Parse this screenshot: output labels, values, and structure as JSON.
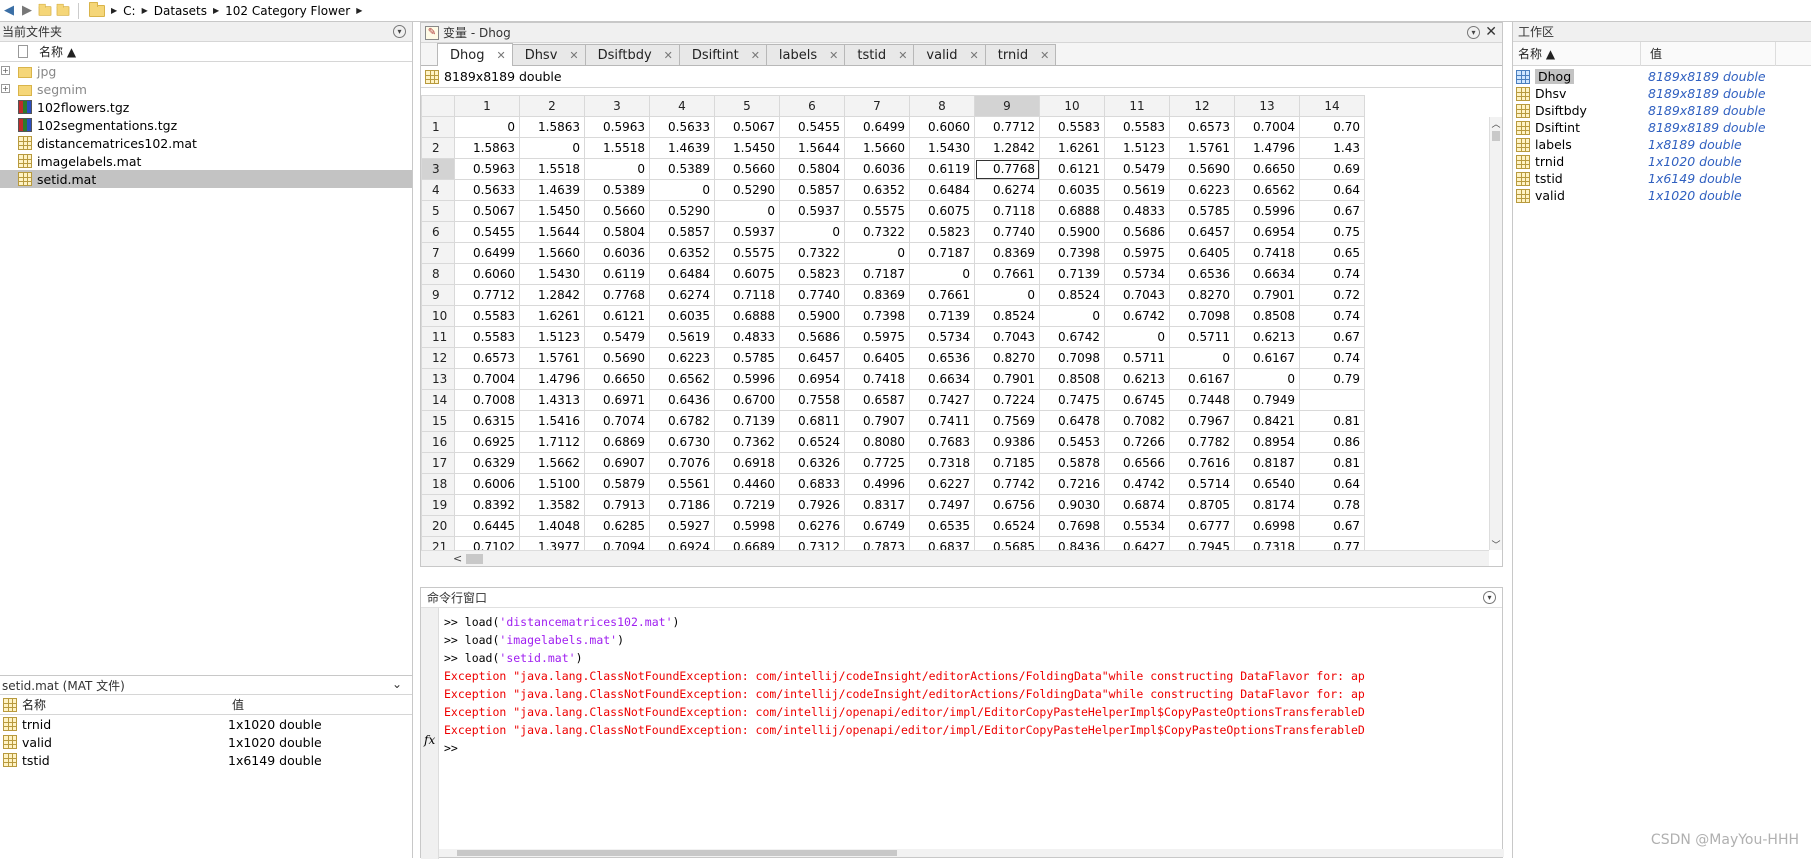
{
  "address": {
    "drive": "C:",
    "crumbs": [
      "Datasets",
      "102 Category Flower"
    ]
  },
  "current_folder": {
    "title": "当前文件夹",
    "col_name": "名称 ▲",
    "items": [
      {
        "name": "jpg",
        "type": "folder",
        "dim": true
      },
      {
        "name": "segmim",
        "type": "folder",
        "dim": true
      },
      {
        "name": "102flowers.tgz",
        "type": "tgz"
      },
      {
        "name": "102segmentations.tgz",
        "type": "tgz"
      },
      {
        "name": "distancematrices102.mat",
        "type": "mat"
      },
      {
        "name": "imagelabels.mat",
        "type": "mat"
      },
      {
        "name": "setid.mat",
        "type": "mat",
        "selected": true
      }
    ]
  },
  "details": {
    "title": "setid.mat  (MAT 文件)",
    "col_name": "名称",
    "col_value": "值",
    "items": [
      {
        "name": "trnid",
        "value": "1x1020 double"
      },
      {
        "name": "valid",
        "value": "1x1020 double"
      },
      {
        "name": "tstid",
        "value": "1x6149 double"
      }
    ]
  },
  "variable_editor": {
    "title": "变量 - Dhog",
    "tabs": [
      "Dhog",
      "Dhsv",
      "Dsiftbdy",
      "Dsiftint",
      "labels",
      "tstid",
      "valid",
      "trnid"
    ],
    "active_tab": "Dhog",
    "size_label": "8189x8189 double",
    "columns": [
      "1",
      "2",
      "3",
      "4",
      "5",
      "6",
      "7",
      "8",
      "9",
      "10",
      "11",
      "12",
      "13",
      "14"
    ],
    "rows": [
      [
        "0",
        "1.5863",
        "0.5963",
        "0.5633",
        "0.5067",
        "0.5455",
        "0.6499",
        "0.6060",
        "0.7712",
        "0.5583",
        "0.5583",
        "0.6573",
        "0.7004",
        "0.70"
      ],
      [
        "1.5863",
        "0",
        "1.5518",
        "1.4639",
        "1.5450",
        "1.5644",
        "1.5660",
        "1.5430",
        "1.2842",
        "1.6261",
        "1.5123",
        "1.5761",
        "1.4796",
        "1.43"
      ],
      [
        "0.5963",
        "1.5518",
        "0",
        "0.5389",
        "0.5660",
        "0.5804",
        "0.6036",
        "0.6119",
        "0.7768",
        "0.6121",
        "0.5479",
        "0.5690",
        "0.6650",
        "0.69"
      ],
      [
        "0.5633",
        "1.4639",
        "0.5389",
        "0",
        "0.5290",
        "0.5857",
        "0.6352",
        "0.6484",
        "0.6274",
        "0.6035",
        "0.5619",
        "0.6223",
        "0.6562",
        "0.64"
      ],
      [
        "0.5067",
        "1.5450",
        "0.5660",
        "0.5290",
        "0",
        "0.5937",
        "0.5575",
        "0.6075",
        "0.7118",
        "0.6888",
        "0.4833",
        "0.5785",
        "0.5996",
        "0.67"
      ],
      [
        "0.5455",
        "1.5644",
        "0.5804",
        "0.5857",
        "0.5937",
        "0",
        "0.7322",
        "0.5823",
        "0.7740",
        "0.5900",
        "0.5686",
        "0.6457",
        "0.6954",
        "0.75"
      ],
      [
        "0.6499",
        "1.5660",
        "0.6036",
        "0.6352",
        "0.5575",
        "0.7322",
        "0",
        "0.7187",
        "0.8369",
        "0.7398",
        "0.5975",
        "0.6405",
        "0.7418",
        "0.65"
      ],
      [
        "0.6060",
        "1.5430",
        "0.6119",
        "0.6484",
        "0.6075",
        "0.5823",
        "0.7187",
        "0",
        "0.7661",
        "0.7139",
        "0.5734",
        "0.6536",
        "0.6634",
        "0.74"
      ],
      [
        "0.7712",
        "1.2842",
        "0.7768",
        "0.6274",
        "0.7118",
        "0.7740",
        "0.8369",
        "0.7661",
        "0",
        "0.8524",
        "0.7043",
        "0.8270",
        "0.7901",
        "0.72"
      ],
      [
        "0.5583",
        "1.6261",
        "0.6121",
        "0.6035",
        "0.6888",
        "0.5900",
        "0.7398",
        "0.7139",
        "0.8524",
        "0",
        "0.6742",
        "0.7098",
        "0.8508",
        "0.74"
      ],
      [
        "0.5583",
        "1.5123",
        "0.5479",
        "0.5619",
        "0.4833",
        "0.5686",
        "0.5975",
        "0.5734",
        "0.7043",
        "0.6742",
        "0",
        "0.5711",
        "0.6213",
        "0.67"
      ],
      [
        "0.6573",
        "1.5761",
        "0.5690",
        "0.6223",
        "0.5785",
        "0.6457",
        "0.6405",
        "0.6536",
        "0.8270",
        "0.7098",
        "0.5711",
        "0",
        "0.6167",
        "0.74"
      ],
      [
        "0.7004",
        "1.4796",
        "0.6650",
        "0.6562",
        "0.5996",
        "0.6954",
        "0.7418",
        "0.6634",
        "0.7901",
        "0.8508",
        "0.6213",
        "0.6167",
        "0",
        "0.79"
      ],
      [
        "0.7008",
        "1.4313",
        "0.6971",
        "0.6436",
        "0.6700",
        "0.7558",
        "0.6587",
        "0.7427",
        "0.7224",
        "0.7475",
        "0.6745",
        "0.7448",
        "0.7949",
        ""
      ],
      [
        "0.6315",
        "1.5416",
        "0.7074",
        "0.6782",
        "0.7139",
        "0.6811",
        "0.7907",
        "0.7411",
        "0.7569",
        "0.6478",
        "0.7082",
        "0.7967",
        "0.8421",
        "0.81"
      ],
      [
        "0.6925",
        "1.7112",
        "0.6869",
        "0.6730",
        "0.7362",
        "0.6524",
        "0.8080",
        "0.7683",
        "0.9386",
        "0.5453",
        "0.7266",
        "0.7782",
        "0.8954",
        "0.86"
      ],
      [
        "0.6329",
        "1.5662",
        "0.6907",
        "0.7076",
        "0.6918",
        "0.6326",
        "0.7725",
        "0.7318",
        "0.7185",
        "0.5878",
        "0.6566",
        "0.7616",
        "0.8187",
        "0.81"
      ],
      [
        "0.6006",
        "1.5100",
        "0.5879",
        "0.5561",
        "0.4460",
        "0.6833",
        "0.4996",
        "0.6227",
        "0.7742",
        "0.7216",
        "0.4742",
        "0.5714",
        "0.6540",
        "0.64"
      ],
      [
        "0.8392",
        "1.3582",
        "0.7913",
        "0.7186",
        "0.7219",
        "0.7926",
        "0.8317",
        "0.7497",
        "0.6756",
        "0.9030",
        "0.6874",
        "0.8705",
        "0.8174",
        "0.78"
      ],
      [
        "0.6445",
        "1.4048",
        "0.6285",
        "0.5927",
        "0.5998",
        "0.6276",
        "0.6749",
        "0.6535",
        "0.6524",
        "0.7698",
        "0.5534",
        "0.6777",
        "0.6998",
        "0.67"
      ],
      [
        "0.7102",
        "1.3977",
        "0.7094",
        "0.6924",
        "0.6689",
        "0.7312",
        "0.7873",
        "0.6837",
        "0.5685",
        "0.8436",
        "0.6427",
        "0.7945",
        "0.7318",
        "0.77"
      ]
    ]
  },
  "command_window": {
    "title": "命令行窗口",
    "lines": [
      {
        "prompt": ">> ",
        "pre": "load(",
        "str": "'distancematrices102.mat'",
        "post": ")"
      },
      {
        "prompt": ">> ",
        "pre": "load(",
        "str": "'imagelabels.mat'",
        "post": ")"
      },
      {
        "prompt": ">> ",
        "pre": "load(",
        "str": "'setid.mat'",
        "post": ")"
      }
    ],
    "errors": [
      "Exception \"java.lang.ClassNotFoundException: com/intellij/codeInsight/editorActions/FoldingData\"while constructing DataFlavor for: ap",
      "Exception \"java.lang.ClassNotFoundException: com/intellij/codeInsight/editorActions/FoldingData\"while constructing DataFlavor for: ap",
      "Exception \"java.lang.ClassNotFoundException: com/intellij/openapi/editor/impl/EditorCopyPasteHelperImpl$CopyPasteOptionsTransferableD",
      "Exception \"java.lang.ClassNotFoundException: com/intellij/openapi/editor/impl/EditorCopyPasteHelperImpl$CopyPasteOptionsTransferableD"
    ],
    "fx_label": "fx",
    "prompt": ">>"
  },
  "workspace": {
    "title": "工作区",
    "col_name": "名称 ▲",
    "col_value": "值",
    "items": [
      {
        "name": "Dhog",
        "value": "8189x8189 double",
        "selected": true
      },
      {
        "name": "Dhsv",
        "value": "8189x8189 double"
      },
      {
        "name": "Dsiftbdy",
        "value": "8189x8189 double"
      },
      {
        "name": "Dsiftint",
        "value": "8189x8189 double"
      },
      {
        "name": "labels",
        "value": "1x8189 double"
      },
      {
        "name": "trnid",
        "value": "1x1020 double"
      },
      {
        "name": "tstid",
        "value": "1x6149 double"
      },
      {
        "name": "valid",
        "value": "1x1020 double"
      }
    ]
  },
  "watermark": "CSDN @MayYou-HHH",
  "colors": {
    "error": "#e00000",
    "string": "#a020f0",
    "workspace_value": "#3060c0"
  }
}
